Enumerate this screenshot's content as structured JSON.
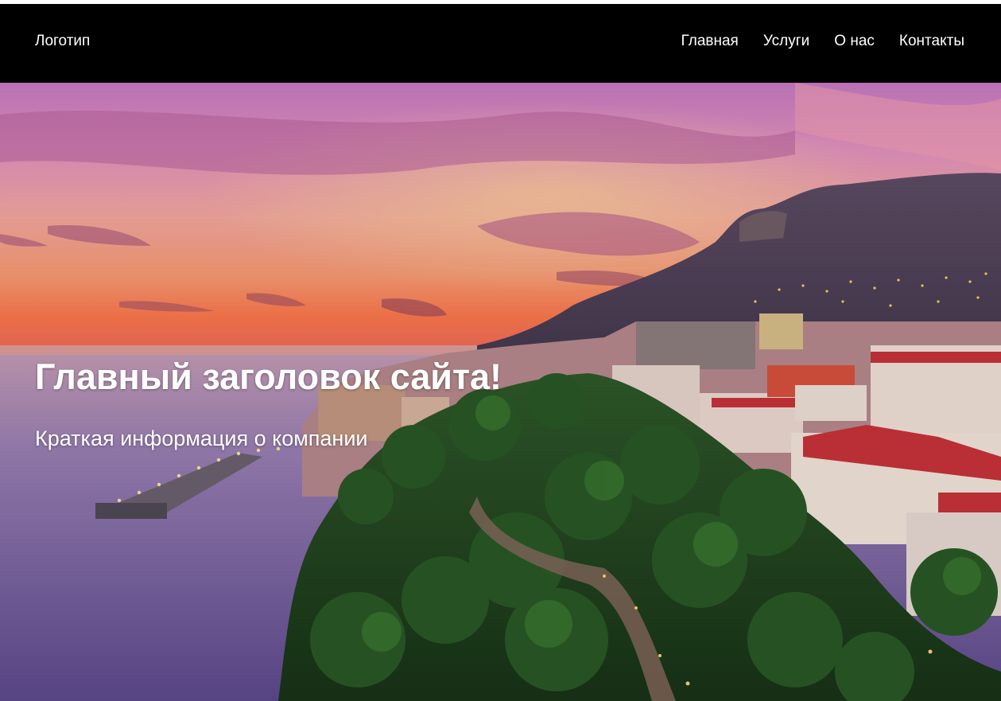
{
  "header": {
    "logo": "Логотип",
    "nav": [
      {
        "label": "Главная"
      },
      {
        "label": "Услуги"
      },
      {
        "label": "О нас"
      },
      {
        "label": "Контакты"
      }
    ]
  },
  "hero": {
    "title": "Главный заголовок сайта!",
    "subtitle": "Краткая информация о компании"
  },
  "colors": {
    "header_bg": "#000000",
    "text": "#ffffff",
    "sky_top": "#d77bb8",
    "sky_horizon": "#f58a6a",
    "sea": "#6a5a9a",
    "mountain": "#4a3d55",
    "trees": "#1f4a1e",
    "roofs": "#c9333a"
  }
}
